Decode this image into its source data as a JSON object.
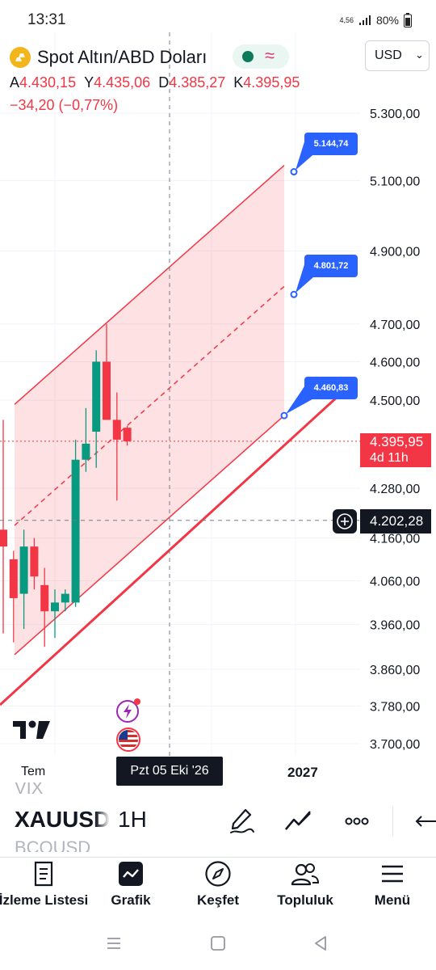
{
  "status_bar": {
    "time": "13:31",
    "network": "4,56",
    "battery": "80%"
  },
  "header": {
    "symbol_title": "Spot Altın/ABD Doları",
    "currency": "USD",
    "ohlc": [
      {
        "key": "A",
        "value": "4.430,15"
      },
      {
        "key": "Y",
        "value": "4.435,06"
      },
      {
        "key": "D",
        "value": "4.385,27"
      },
      {
        "key": "K",
        "value": "4.395,95"
      }
    ],
    "change": "−34,20 (−0,77%)",
    "colors": {
      "down": "#f23645",
      "up": "#089981",
      "market_open": "#0e7a5a"
    }
  },
  "chart_data": {
    "type": "candlestick",
    "symbol": "XAUUSD",
    "interval": "1H",
    "y_scale": "log",
    "ylim": [
      3650,
      5400
    ],
    "y_ticks": [
      {
        "value": 5300,
        "label": "5.300,00"
      },
      {
        "value": 5100,
        "label": "5.100,00"
      },
      {
        "value": 4900,
        "label": "4.900,00"
      },
      {
        "value": 4700,
        "label": "4.700,00"
      },
      {
        "value": 4600,
        "label": "4.600,00"
      },
      {
        "value": 4500,
        "label": "4.500,00"
      },
      {
        "value": 4280,
        "label": "4.280,00"
      },
      {
        "value": 4160,
        "label": "4.160,00"
      },
      {
        "value": 4060,
        "label": "4.060,00"
      },
      {
        "value": 3960,
        "label": "3.960,00"
      },
      {
        "value": 3860,
        "label": "3.860,00"
      },
      {
        "value": 3780,
        "label": "3.780,00"
      },
      {
        "value": 3700,
        "label": "3.700,00"
      }
    ],
    "x_ticks": [
      {
        "label": "Tem"
      },
      {
        "label": "2027"
      }
    ],
    "candles": [
      {
        "o": 4180,
        "h": 4450,
        "l": 3940,
        "c": 4140
      },
      {
        "o": 4110,
        "h": 4130,
        "l": 3920,
        "c": 4020
      },
      {
        "o": 4030,
        "h": 4180,
        "l": 3950,
        "c": 4140
      },
      {
        "o": 4140,
        "h": 4160,
        "l": 4040,
        "c": 4070
      },
      {
        "o": 4050,
        "h": 4090,
        "l": 3910,
        "c": 3990
      },
      {
        "o": 3990,
        "h": 4040,
        "l": 3930,
        "c": 4010
      },
      {
        "o": 4010,
        "h": 4040,
        "l": 3990,
        "c": 4030
      },
      {
        "o": 4010,
        "h": 4400,
        "l": 4000,
        "c": 4350
      },
      {
        "o": 4350,
        "h": 4480,
        "l": 4320,
        "c": 4390
      },
      {
        "o": 4420,
        "h": 4630,
        "l": 4330,
        "c": 4600
      },
      {
        "o": 4600,
        "h": 4700,
        "l": 4450,
        "c": 4450
      },
      {
        "o": 4450,
        "h": 4520,
        "l": 4250,
        "c": 4400
      },
      {
        "o": 4430,
        "h": 4435.06,
        "l": 4385.27,
        "c": 4395.95
      }
    ],
    "channel": {
      "upper_end": 5144.74,
      "mid_end": 4801.72,
      "lower_end": 4460.83,
      "labels": [
        "5.144,74",
        "4.801,72",
        "4.460,83"
      ]
    },
    "last_price": {
      "value": 4395.95,
      "label": "4.395,95",
      "countdown": "4d 11h"
    },
    "crosshair": {
      "price_label": "4.202,28",
      "date_label": "Pzt 05 Eki '26"
    }
  },
  "toolbar": {
    "symbol": "XAUUSD",
    "symbol_prev": "VIX",
    "symbol_next": "BCOUSD",
    "interval": "1H",
    "icons": [
      "pencil-icon",
      "drawings-icon",
      "more-icon",
      "undo-icon"
    ]
  },
  "bottom_nav": [
    {
      "label": "İzleme Listesi",
      "icon": "list-icon"
    },
    {
      "label": "Grafik",
      "icon": "chart-icon"
    },
    {
      "label": "Keşfet",
      "icon": "compass-icon"
    },
    {
      "label": "Topluluk",
      "icon": "users-icon"
    },
    {
      "label": "Menü",
      "icon": "menu-icon"
    }
  ]
}
